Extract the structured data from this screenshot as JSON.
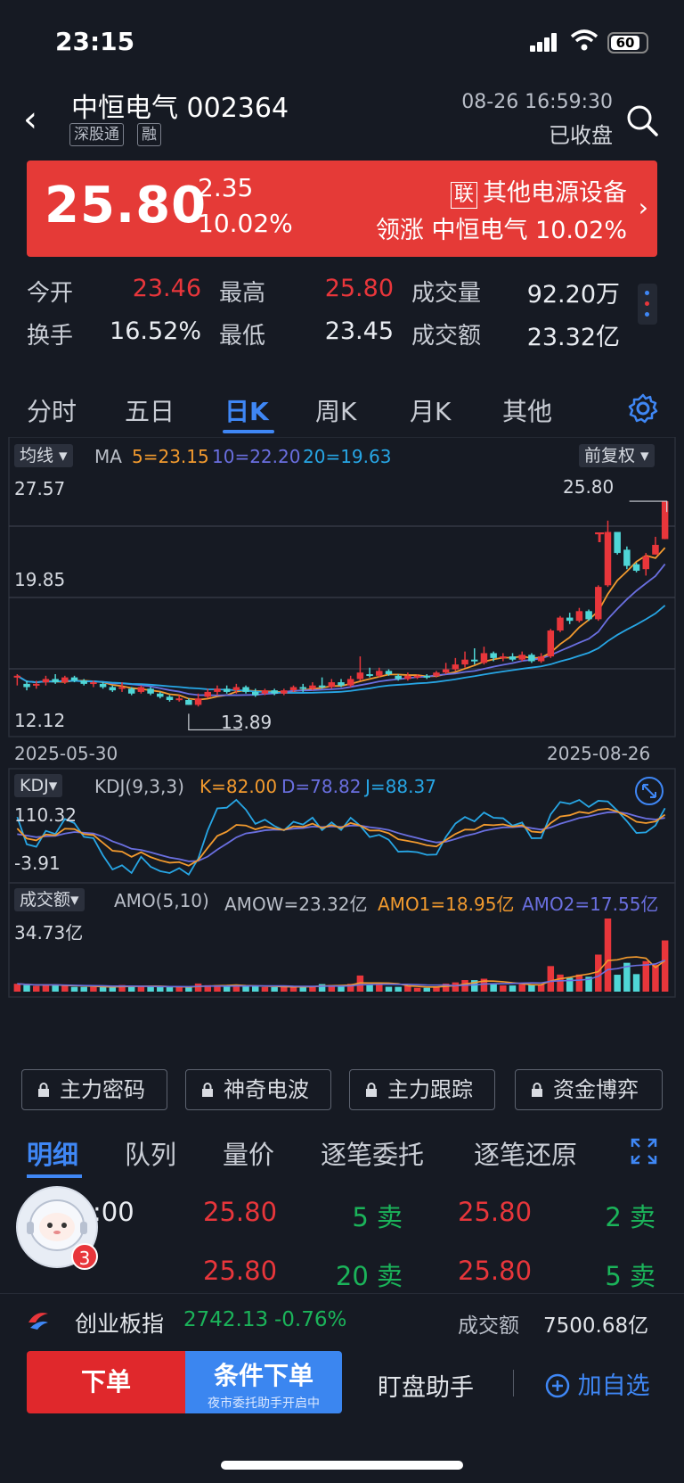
{
  "status": {
    "time": "23:15",
    "battery": "60"
  },
  "header": {
    "name": "中恒电气 002364",
    "tags": [
      "深股通",
      "融"
    ],
    "datetime": "08-26 16:59:30",
    "market_status": "已收盘"
  },
  "banner": {
    "price": "25.80",
    "change": "2.35",
    "change_pct": "10.02%",
    "sector_tag": "联",
    "sector": "其他电源设备",
    "leader_label": "领涨",
    "leader": "中恒电气 10.02%",
    "bg": "#e53a37"
  },
  "stats": {
    "row1": [
      {
        "label": "今开",
        "value": "23.46",
        "tone": "red"
      },
      {
        "label": "最高",
        "value": "25.80",
        "tone": "red"
      },
      {
        "label": "成交量",
        "value": "92.20万",
        "tone": "white"
      }
    ],
    "row2": [
      {
        "label": "换手",
        "value": "16.52%",
        "tone": "white"
      },
      {
        "label": "最低",
        "value": "23.45",
        "tone": "white"
      },
      {
        "label": "成交额",
        "value": "23.32亿",
        "tone": "white"
      }
    ]
  },
  "tabs": [
    "分时",
    "五日",
    "日K",
    "周K",
    "月K",
    "其他"
  ],
  "active_tab": "日K",
  "kline": {
    "ma_button": "均线",
    "ma_label": "MA",
    "ma5": "5=23.15",
    "ma10": "10=22.20",
    "ma20": "20=19.63",
    "adjust": "前复权",
    "y_top": "27.57",
    "y_mid": "19.85",
    "y_bot": "12.12",
    "max_label": "25.80",
    "min_label": "13.89",
    "marker": "T",
    "date_start": "2025-05-30",
    "date_end": "2025-08-26"
  },
  "kdj": {
    "button": "KDJ",
    "params": "KDJ(9,3,3)",
    "k": "K=82.00",
    "d": "D=78.82",
    "j": "J=88.37",
    "y_top": "110.32",
    "y_bot": "-3.91"
  },
  "amo": {
    "button": "成交额",
    "params": "AMO(5,10)",
    "amow": "AMOW=23.32亿",
    "amo1": "AMO1=18.95亿",
    "amo2": "AMO2=17.55亿",
    "y_top": "34.73亿"
  },
  "chart_data": {
    "type": "candlestick",
    "ylim": [
      12.12,
      27.57
    ],
    "x_start": "2025-05-30",
    "x_end": "2025-08-26",
    "candles": [
      [
        14.9,
        15.0,
        14.4,
        15.1
      ],
      [
        14.5,
        14.3,
        14.1,
        14.7
      ],
      [
        14.4,
        14.5,
        14.2,
        14.7
      ],
      [
        14.6,
        14.8,
        14.4,
        15.0
      ],
      [
        14.8,
        14.6,
        14.5,
        15.1
      ],
      [
        14.6,
        14.9,
        14.5,
        15.0
      ],
      [
        14.9,
        14.7,
        14.6,
        15.0
      ],
      [
        14.7,
        14.5,
        14.4,
        14.8
      ],
      [
        14.5,
        14.6,
        14.3,
        14.7
      ],
      [
        14.5,
        14.3,
        14.2,
        14.6
      ],
      [
        14.3,
        14.1,
        14.0,
        14.4
      ],
      [
        14.2,
        14.3,
        14.0,
        14.6
      ],
      [
        14.2,
        13.9,
        13.8,
        14.3
      ],
      [
        14.0,
        14.3,
        13.9,
        14.4
      ],
      [
        14.2,
        13.9,
        13.8,
        14.3
      ],
      [
        13.9,
        13.7,
        13.6,
        14.0
      ],
      [
        13.7,
        13.5,
        13.4,
        13.8
      ],
      [
        13.5,
        13.6,
        13.4,
        13.8
      ],
      [
        13.5,
        13.2,
        13.2,
        13.6
      ],
      [
        13.2,
        13.6,
        13.1,
        13.9
      ],
      [
        13.7,
        14.0,
        13.6,
        14.2
      ],
      [
        14.0,
        14.2,
        13.8,
        14.4
      ],
      [
        14.2,
        14.0,
        13.9,
        14.4
      ],
      [
        14.1,
        14.3,
        13.9,
        14.5
      ],
      [
        14.3,
        14.0,
        13.9,
        14.4
      ],
      [
        14.0,
        13.8,
        13.7,
        14.2
      ],
      [
        13.9,
        14.1,
        13.8,
        14.2
      ],
      [
        14.1,
        13.9,
        13.8,
        14.2
      ],
      [
        13.9,
        14.1,
        13.8,
        14.2
      ],
      [
        14.1,
        14.3,
        14.0,
        14.4
      ],
      [
        14.3,
        14.2,
        14.0,
        14.5
      ],
      [
        14.2,
        14.4,
        14.1,
        14.6
      ],
      [
        14.4,
        14.3,
        14.2,
        14.9
      ],
      [
        14.3,
        14.6,
        14.2,
        14.8
      ],
      [
        14.6,
        14.4,
        14.3,
        14.8
      ],
      [
        14.4,
        14.8,
        14.3,
        15.0
      ],
      [
        14.8,
        15.2,
        14.7,
        16.2
      ],
      [
        15.1,
        15.0,
        14.9,
        15.5
      ],
      [
        15.0,
        15.3,
        14.9,
        15.5
      ],
      [
        15.3,
        15.1,
        15.0,
        15.4
      ],
      [
        15.0,
        14.8,
        14.7,
        15.1
      ],
      [
        14.8,
        15.0,
        14.7,
        15.2
      ],
      [
        15.0,
        15.0,
        14.8,
        15.1
      ],
      [
        15.0,
        14.9,
        14.8,
        15.1
      ],
      [
        15.0,
        15.2,
        14.9,
        15.3
      ],
      [
        15.2,
        15.4,
        15.1,
        15.8
      ],
      [
        15.4,
        15.7,
        15.3,
        16.1
      ],
      [
        15.7,
        16.0,
        15.5,
        16.5
      ],
      [
        16.0,
        15.9,
        15.7,
        16.7
      ],
      [
        15.8,
        16.4,
        15.7,
        16.8
      ],
      [
        16.4,
        16.1,
        15.9,
        16.5
      ],
      [
        16.1,
        16.2,
        15.9,
        16.4
      ],
      [
        16.2,
        16.0,
        15.9,
        16.4
      ],
      [
        16.0,
        16.3,
        15.9,
        16.5
      ],
      [
        16.3,
        15.9,
        15.8,
        16.4
      ],
      [
        15.9,
        16.2,
        15.8,
        16.4
      ],
      [
        16.2,
        17.8,
        16.1,
        17.9
      ],
      [
        17.8,
        18.6,
        17.7,
        18.7
      ],
      [
        18.6,
        18.4,
        18.2,
        18.9
      ],
      [
        18.4,
        19.0,
        18.3,
        19.2
      ],
      [
        19.0,
        18.5,
        18.4,
        19.1
      ],
      [
        18.5,
        20.5,
        18.4,
        20.6
      ],
      [
        20.6,
        23.9,
        20.5,
        24.6
      ],
      [
        23.9,
        22.6,
        22.5,
        23.1
      ],
      [
        22.8,
        21.8,
        21.6,
        23.0
      ],
      [
        21.9,
        21.5,
        21.4,
        22.0
      ],
      [
        21.6,
        22.4,
        21.2,
        22.6
      ],
      [
        22.5,
        23.1,
        22.5,
        23.6
      ],
      [
        23.46,
        25.8,
        23.45,
        25.8
      ]
    ],
    "ma_series": [
      {
        "name": "5",
        "last": 23.15
      },
      {
        "name": "10",
        "last": 22.2
      },
      {
        "name": "20",
        "last": 19.63
      }
    ],
    "kdj": {
      "K": 82.0,
      "D": 78.82,
      "J": 88.37,
      "ylim": [
        -3.91,
        110.32
      ]
    },
    "amo": {
      "AMOW": "23.32亿",
      "AMO1": "18.95亿",
      "AMO2": "17.55亿",
      "ymax": "34.73亿"
    }
  },
  "toolbar": [
    "主力密码",
    "神奇电波",
    "主力跟踪",
    "资金博弈"
  ],
  "subtabs": [
    "明细",
    "队列",
    "量价",
    "逐笔委托",
    "逐笔还原"
  ],
  "trades": {
    "time_fragment": ":00",
    "rows": [
      [
        "25.80",
        "5 卖",
        "25.80",
        "2 卖"
      ],
      [
        "25.80",
        "20 卖",
        "25.80",
        "5 卖"
      ]
    ],
    "badge": "3"
  },
  "index": {
    "name": "创业板指",
    "value": "2742.13",
    "change": "-0.76%",
    "amount_label": "成交额",
    "amount": "7500.68亿"
  },
  "bottom": {
    "order": "下单",
    "cond": "条件下单",
    "cond_sub": "夜市委托助手开启中",
    "helper": "盯盘助手",
    "addfav": "加自选"
  },
  "colors": {
    "up": "#e8363b",
    "down": "#4fd6d6",
    "ma5": "#f29a2e",
    "ma10": "#6a6fe0",
    "ma20": "#27a6e5",
    "accent": "#3f87f5"
  }
}
